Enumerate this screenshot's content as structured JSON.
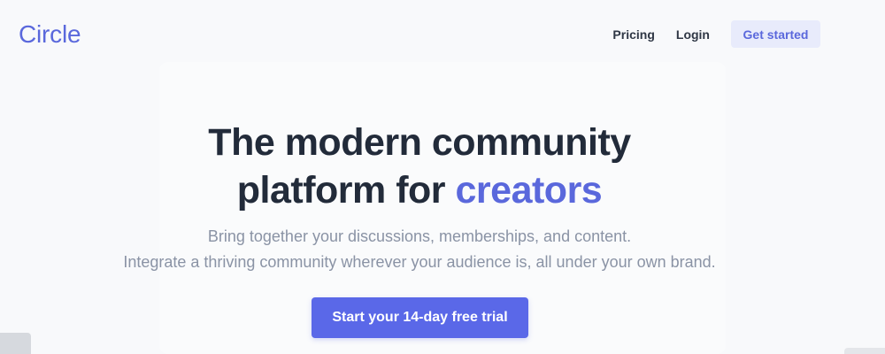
{
  "brand": {
    "logo_text": "Circle",
    "accent_color": "#5a68dc"
  },
  "nav": {
    "items": [
      {
        "label": "Pricing"
      },
      {
        "label": "Login"
      }
    ],
    "cta_label": "Get started"
  },
  "hero": {
    "title_line1": "The modern community",
    "title_line2_prefix": "platform for",
    "title_line2_accent": "creators",
    "subtitle_line1": "Bring together your discussions, memberships, and content.",
    "subtitle_line2": "Integrate a thriving community wherever your audience is, all under your own brand.",
    "cta_label": "Start your 14-day free trial"
  }
}
